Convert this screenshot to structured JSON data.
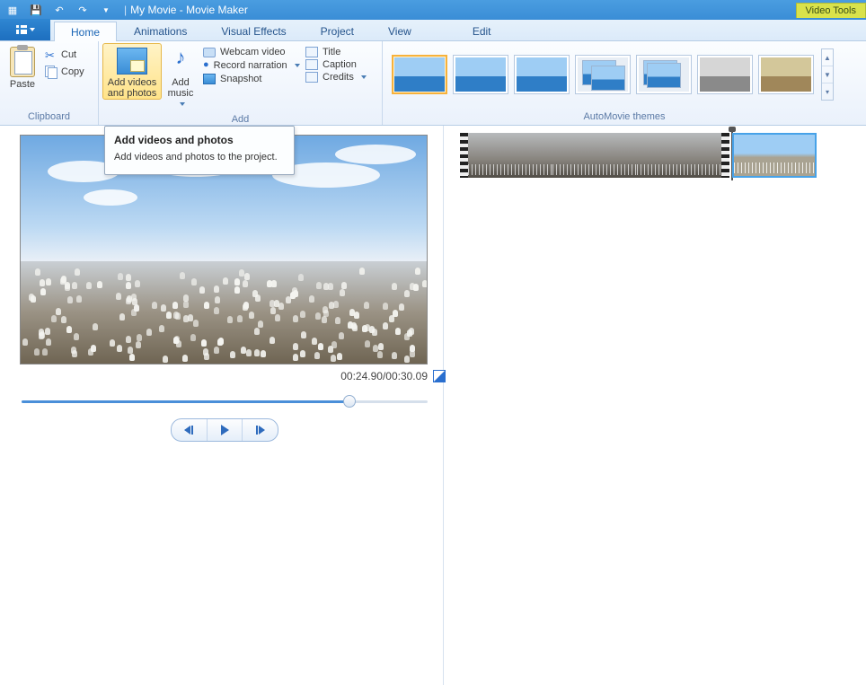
{
  "titlebar": {
    "title": "My Movie - Movie Maker",
    "context_tab": "Video Tools"
  },
  "tabs": {
    "home": "Home",
    "animations": "Animations",
    "visual_effects": "Visual Effects",
    "project": "Project",
    "view": "View",
    "edit": "Edit"
  },
  "ribbon": {
    "clipboard": {
      "group_label": "Clipboard",
      "paste": "Paste",
      "cut": "Cut",
      "copy": "Copy"
    },
    "add": {
      "group_label": "Add",
      "add_videos_line1": "Add videos",
      "add_videos_line2": "and photos",
      "add_music_line1": "Add",
      "add_music_line2": "music",
      "webcam": "Webcam video",
      "record_narration": "Record narration",
      "snapshot": "Snapshot",
      "title": "Title",
      "caption": "Caption",
      "credits": "Credits"
    },
    "themes": {
      "group_label": "AutoMovie themes"
    }
  },
  "tooltip": {
    "title": "Add videos and photos",
    "body": "Add videos and photos to the project."
  },
  "preview": {
    "time": "00:24.90/00:30.09",
    "slider_pct": 80.8
  }
}
